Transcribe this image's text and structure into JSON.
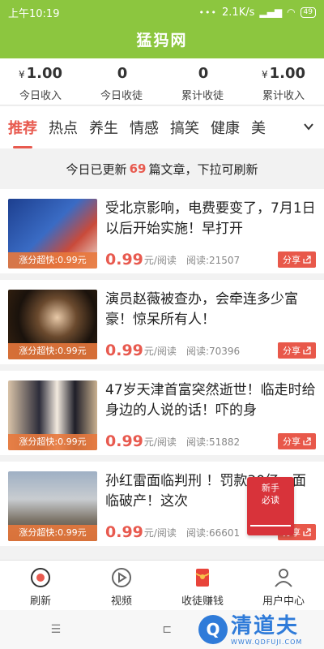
{
  "status": {
    "time": "上午10:19",
    "speed": "2.1K/s",
    "battery": "49"
  },
  "app": {
    "title": "猛犸网"
  },
  "stats": [
    {
      "currency": "¥",
      "value": "1.00",
      "label": "今日收入"
    },
    {
      "currency": "",
      "value": "0",
      "label": "今日收徒"
    },
    {
      "currency": "",
      "value": "0",
      "label": "累计收徒"
    },
    {
      "currency": "¥",
      "value": "1.00",
      "label": "累计收入"
    }
  ],
  "tabs": [
    "推荐",
    "热点",
    "养生",
    "情感",
    "搞笑",
    "健康",
    "美"
  ],
  "notice": {
    "prefix": "今日已更新",
    "count": "69",
    "suffix": "篇文章，下拉可刷新"
  },
  "articles": [
    {
      "title": "受北京影响，电费要变了，7月1日以后开始实施！早打开",
      "tag": "涨分超快:0.99元",
      "price": "0.99",
      "unit": "元/阅读",
      "reads": "阅读:21507",
      "share": "分享"
    },
    {
      "title": "演员赵薇被查办，会牵连多少富豪！惊呆所有人！",
      "tag": "涨分超快:0.99元",
      "price": "0.99",
      "unit": "元/阅读",
      "reads": "阅读:70396",
      "share": "分享"
    },
    {
      "title": "47岁天津首富突然逝世！临走时给身边的人说的话！吓的身",
      "tag": "涨分超快:0.99元",
      "price": "0.99",
      "unit": "元/阅读",
      "reads": "阅读:51882",
      "share": "分享"
    },
    {
      "title": "孙红雷面临判刑 ！罚款30亿，面临破产！这次",
      "tag": "涨分超快:0.99元",
      "price": "0.99",
      "unit": "元/阅读",
      "reads": "阅读:66601",
      "share": "分享"
    }
  ],
  "badge": {
    "line1": "新手",
    "line2": "必读"
  },
  "nav": [
    {
      "label": "刷新",
      "icon": "refresh-icon"
    },
    {
      "label": "视频",
      "icon": "play-icon"
    },
    {
      "label": "收徒赚钱",
      "icon": "red-envelope-icon"
    },
    {
      "label": "用户中心",
      "icon": "user-icon"
    }
  ],
  "sysnav": {
    "menu": "☰",
    "home": "⊏"
  },
  "watermark": {
    "title": "清道夫",
    "url": "WWW.QDFUJI.COM"
  },
  "colors": {
    "brand": "#8cc63f",
    "accent": "#e85a4f"
  }
}
